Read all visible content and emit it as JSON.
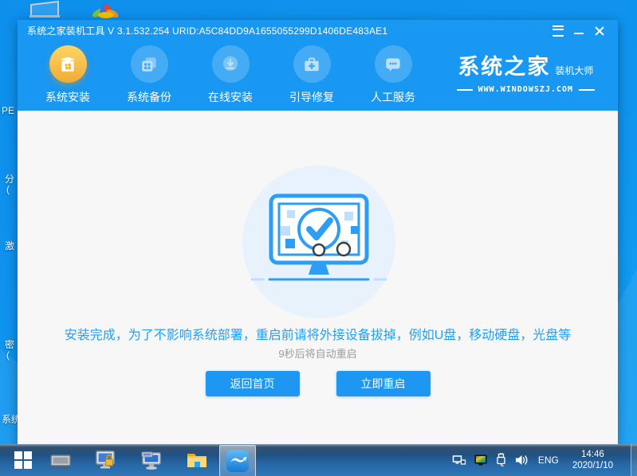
{
  "colors": {
    "header_blue": "#1897F3",
    "active_gold": "#F0AC35",
    "message_blue": "#1E9FFF",
    "button_blue": "#1E97F2",
    "content_bg": "#F7F7F8",
    "desktop_blue": "#0F95EF",
    "countdown_gray": "#9B9B9B"
  },
  "desktop": {
    "fragments": [
      "PE",
      "分",
      "(",
      "激",
      "密",
      "(",
      "系统"
    ]
  },
  "window": {
    "title": "系统之家装机工具 V 3.1.532.254 URID:A5C84DD9A1655055299D1406DE483AE1",
    "controls": {
      "menu": "menu",
      "minimize": "minimize",
      "close": "close"
    },
    "nav": {
      "items": [
        {
          "label": "系统安装",
          "icon": "system-install-icon",
          "active": true
        },
        {
          "label": "系统备份",
          "icon": "system-backup-icon",
          "active": false
        },
        {
          "label": "在线安装",
          "icon": "online-install-icon",
          "active": false
        },
        {
          "label": "引导修复",
          "icon": "boot-repair-icon",
          "active": false
        },
        {
          "label": "人工服务",
          "icon": "support-service-icon",
          "active": false
        }
      ]
    },
    "logo": {
      "brand": "系统之家",
      "sub": "装机大师",
      "site": "WWW.WINDOWSZJ.COM"
    },
    "main": {
      "message": "安装完成，为了不影响系统部署，重启前请将外接设备拔掉，例如U盘，移动硬盘，光盘等",
      "countdown": "9秒后将自动重启",
      "back_button": "返回首页",
      "restart_button": "立即重启"
    }
  },
  "taskbar": {
    "language": "ENG",
    "time": "14:46",
    "date": "2020/1/10"
  }
}
